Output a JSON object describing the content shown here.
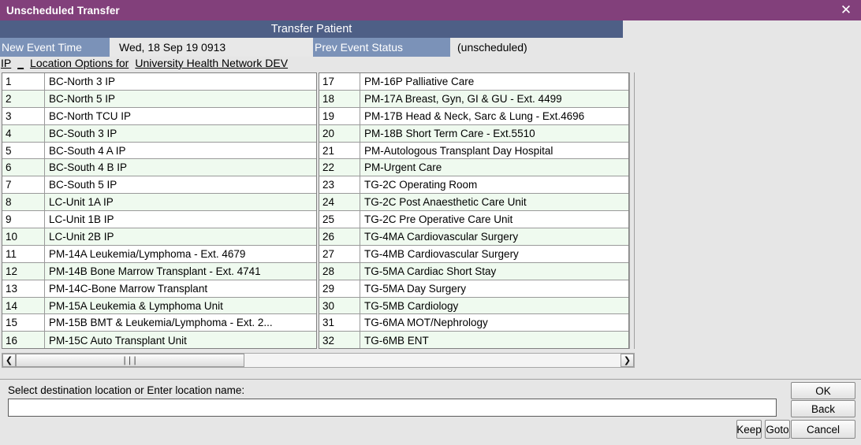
{
  "window": {
    "title": "Unscheduled Transfer",
    "close_icon": "close-icon",
    "close_glyph": "✕",
    "accent_title_bg": "#82407b",
    "band_bg": "#4e5f86",
    "label_bg": "#7b92b8",
    "row_alt_bg": "#effaef"
  },
  "band": {
    "title": "Transfer Patient"
  },
  "fields": {
    "new_event_time_label": "New Event Time",
    "new_event_time_value": "Wed, 18 Sep 19  0913",
    "prev_event_status_label": "Prev Event Status",
    "prev_event_status_value": "(unscheduled)"
  },
  "options_header": {
    "scope": "IP",
    "separator": "_",
    "text": "Location Options for",
    "org": "University Health Network DEV"
  },
  "locations": {
    "left": [
      {
        "num": "1",
        "name": "BC-North 3 IP"
      },
      {
        "num": "2",
        "name": "BC-North 5 IP"
      },
      {
        "num": "3",
        "name": "BC-North TCU IP"
      },
      {
        "num": "4",
        "name": "BC-South 3 IP"
      },
      {
        "num": "5",
        "name": "BC-South 4 A IP"
      },
      {
        "num": "6",
        "name": "BC-South 4 B IP"
      },
      {
        "num": "7",
        "name": "BC-South 5 IP"
      },
      {
        "num": "8",
        "name": "LC-Unit 1A IP"
      },
      {
        "num": "9",
        "name": "LC-Unit 1B IP"
      },
      {
        "num": "10",
        "name": "LC-Unit 2B IP"
      },
      {
        "num": "11",
        "name": "PM-14A Leukemia/Lymphoma - Ext. 4679"
      },
      {
        "num": "12",
        "name": "PM-14B Bone Marrow Transplant - Ext. 4741"
      },
      {
        "num": "13",
        "name": "PM-14C-Bone Marrow Transplant"
      },
      {
        "num": "14",
        "name": "PM-15A Leukemia & Lymphoma Unit"
      },
      {
        "num": "15",
        "name": "PM-15B BMT & Leukemia/Lymphoma - Ext. 2..."
      },
      {
        "num": "16",
        "name": "PM-15C Auto Transplant Unit"
      }
    ],
    "right": [
      {
        "num": "17",
        "name": "PM-16P Palliative Care"
      },
      {
        "num": "18",
        "name": "PM-17A Breast, Gyn, GI & GU - Ext. 4499"
      },
      {
        "num": "19",
        "name": "PM-17B Head & Neck, Sarc & Lung - Ext.4696"
      },
      {
        "num": "20",
        "name": "PM-18B Short Term Care - Ext.5510"
      },
      {
        "num": "21",
        "name": "PM-Autologous Transplant Day Hospital"
      },
      {
        "num": "22",
        "name": "PM-Urgent Care"
      },
      {
        "num": "23",
        "name": "TG-2C Operating Room"
      },
      {
        "num": "24",
        "name": "TG-2C Post Anaesthetic Care Unit"
      },
      {
        "num": "25",
        "name": "TG-2C Pre Operative Care Unit"
      },
      {
        "num": "26",
        "name": "TG-4MA Cardiovascular Surgery"
      },
      {
        "num": "27",
        "name": "TG-4MB Cardiovascular Surgery"
      },
      {
        "num": "28",
        "name": "TG-5MA Cardiac Short Stay"
      },
      {
        "num": "29",
        "name": "TG-5MA Day Surgery"
      },
      {
        "num": "30",
        "name": "TG-5MB Cardiology"
      },
      {
        "num": "31",
        "name": "TG-6MA MOT/Nephrology"
      },
      {
        "num": "32",
        "name": "TG-6MB ENT"
      }
    ]
  },
  "scrollbar": {
    "left_arrow": "❮",
    "right_arrow": "❯",
    "grip": "∣∣∣"
  },
  "bottom": {
    "prompt": "Select destination location or Enter location name:",
    "input_value": "",
    "input_placeholder": ""
  },
  "buttons": {
    "ok": "OK",
    "back": "Back",
    "cancel": "Cancel",
    "keep": "Keep",
    "goto": "Goto"
  }
}
